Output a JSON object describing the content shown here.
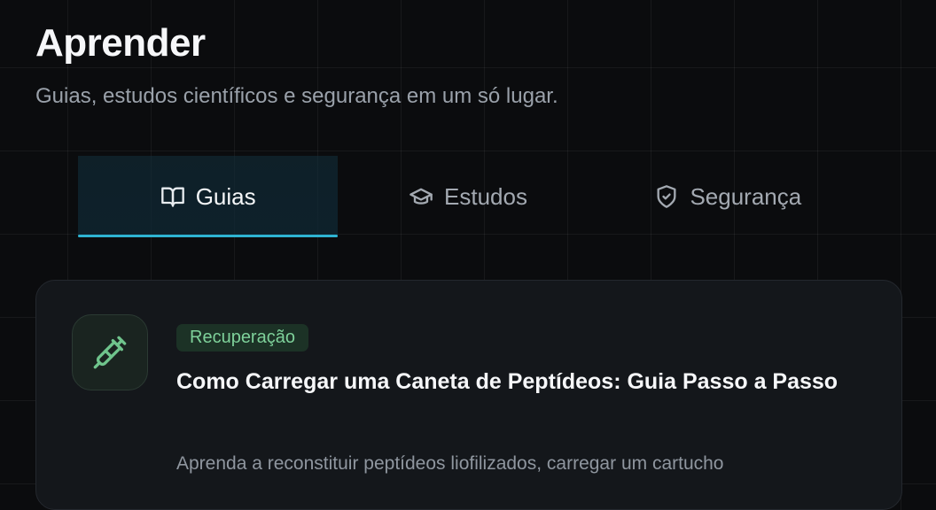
{
  "header": {
    "title": "Aprender",
    "subtitle": "Guias, estudos científicos e segurança em um só lugar."
  },
  "tabs": [
    {
      "label": "Guias",
      "icon": "book-open-icon",
      "active": true
    },
    {
      "label": "Estudos",
      "icon": "graduation-cap-icon",
      "active": false
    },
    {
      "label": "Segurança",
      "icon": "shield-check-icon",
      "active": false
    }
  ],
  "colors": {
    "accent": "#2eb4d2",
    "tag_text": "#7ed19a",
    "tag_background": "#1c3226",
    "background": "#0b0c0e",
    "card_background": "#14171b"
  },
  "cards": [
    {
      "icon": "syringe-icon",
      "tag": "Recuperação",
      "title": "Como Carregar uma Caneta de Peptídeos: Guia Passo a Passo",
      "description": "Aprenda a reconstituir peptídeos liofilizados, carregar um cartucho"
    }
  ]
}
